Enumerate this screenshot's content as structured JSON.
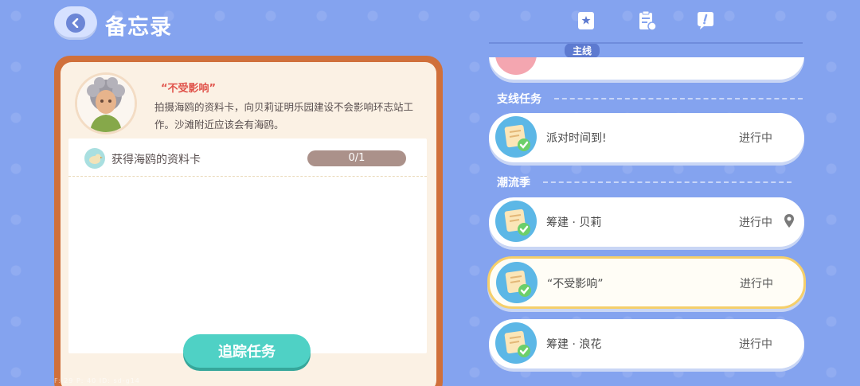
{
  "header": {
    "title": "备忘录",
    "tabs": [
      {
        "name": "main-quest-tab",
        "label": "主线",
        "active": true
      },
      {
        "name": "side-quest-tab",
        "label": "",
        "active": false
      },
      {
        "name": "notes-tab",
        "label": "",
        "active": false
      }
    ]
  },
  "detail": {
    "title": "“不受影响”",
    "description": "拍摄海鸥的资料卡，向贝莉证明乐园建设不会影响环志站工作。沙滩附近应该会有海鸥。",
    "objective": {
      "label": "获得海鸥的资料卡",
      "progress_text": "0/1",
      "progress": 0
    },
    "track_button": "追踪任务"
  },
  "list": {
    "partial_item": {
      "name": "",
      "status": ""
    },
    "sections": [
      {
        "label": "支线任务"
      },
      {
        "label": "潮流季"
      }
    ],
    "items": [
      {
        "name": "派对时间到!",
        "status": "进行中"
      },
      {
        "name": "筹建 · 贝莉",
        "status": "进行中",
        "pinned": true
      },
      {
        "name": "“不受影响”",
        "status": "进行中",
        "selected": true
      },
      {
        "name": "筹建 · 浪花",
        "status": "进行中"
      }
    ]
  },
  "debug": "F: 29   P: 40   ID: sd-g14",
  "colors": {
    "background": "#84a3ef",
    "card_frame": "#d0703b",
    "accent_teal": "#4fd1c5",
    "title_red": "#e0524a",
    "selected_border": "#f5cf6b"
  }
}
